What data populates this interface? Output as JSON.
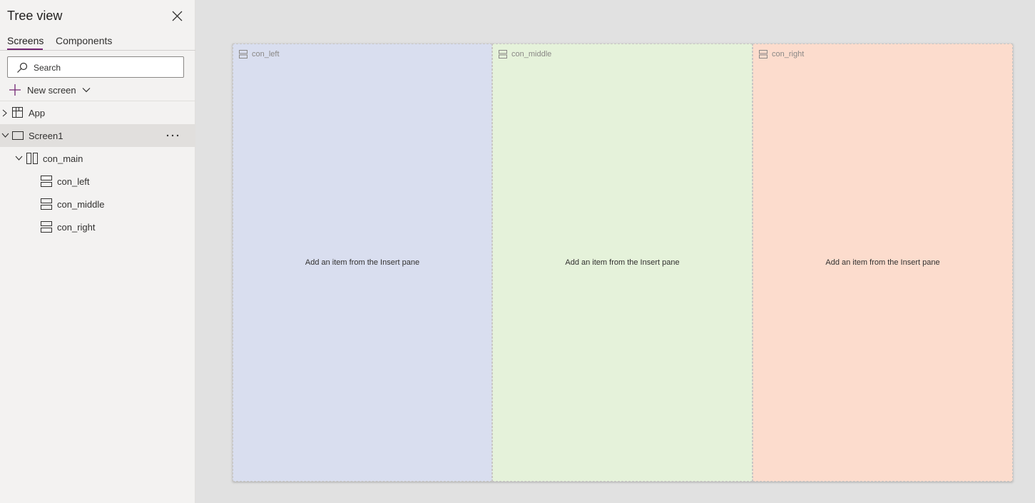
{
  "tree_view": {
    "title": "Tree view",
    "tabs": [
      {
        "label": "Screens",
        "active": true
      },
      {
        "label": "Components",
        "active": false
      }
    ],
    "search": {
      "placeholder": "Search",
      "value": ""
    },
    "new_screen_label": "New screen",
    "items": [
      {
        "label": "App",
        "icon": "app-icon",
        "expanded": false,
        "selected": false
      },
      {
        "label": "Screen1",
        "icon": "screen-icon",
        "expanded": true,
        "selected": true
      },
      {
        "label": "con_main",
        "icon": "horizontal-container-icon",
        "expanded": true,
        "selected": false
      },
      {
        "label": "con_left",
        "icon": "vertical-container-icon",
        "selected": false
      },
      {
        "label": "con_middle",
        "icon": "vertical-container-icon",
        "selected": false
      },
      {
        "label": "con_right",
        "icon": "vertical-container-icon",
        "selected": false
      }
    ]
  },
  "canvas": {
    "containers": [
      {
        "name": "con_left",
        "placeholder": "Add an item from the Insert pane",
        "color": "#d9deef"
      },
      {
        "name": "con_middle",
        "placeholder": "Add an item from the Insert pane",
        "color": "#e5f2da"
      },
      {
        "name": "con_right",
        "placeholder": "Add an item from the Insert pane",
        "color": "#fcdccd"
      }
    ]
  },
  "colors": {
    "accent": "#742774",
    "pane_bg": "#f3f2f1",
    "workspace_bg": "#e1e1e1"
  }
}
